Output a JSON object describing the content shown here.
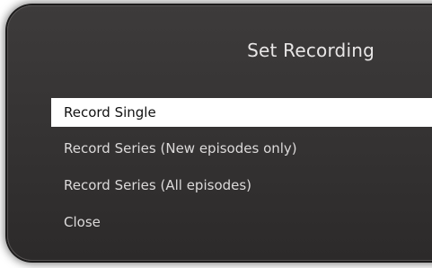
{
  "dialog": {
    "title": "Set Recording",
    "items": [
      {
        "label": "Record Single",
        "selected": true
      },
      {
        "label": "Record Series (New episodes only)",
        "selected": false
      },
      {
        "label": "Record Series (All episodes)",
        "selected": false
      },
      {
        "label": "Close",
        "selected": false
      }
    ]
  },
  "colors": {
    "dialog_background": "#363434",
    "selected_background": "#ffffff",
    "text": "#dcdada",
    "selected_text": "#111111"
  }
}
